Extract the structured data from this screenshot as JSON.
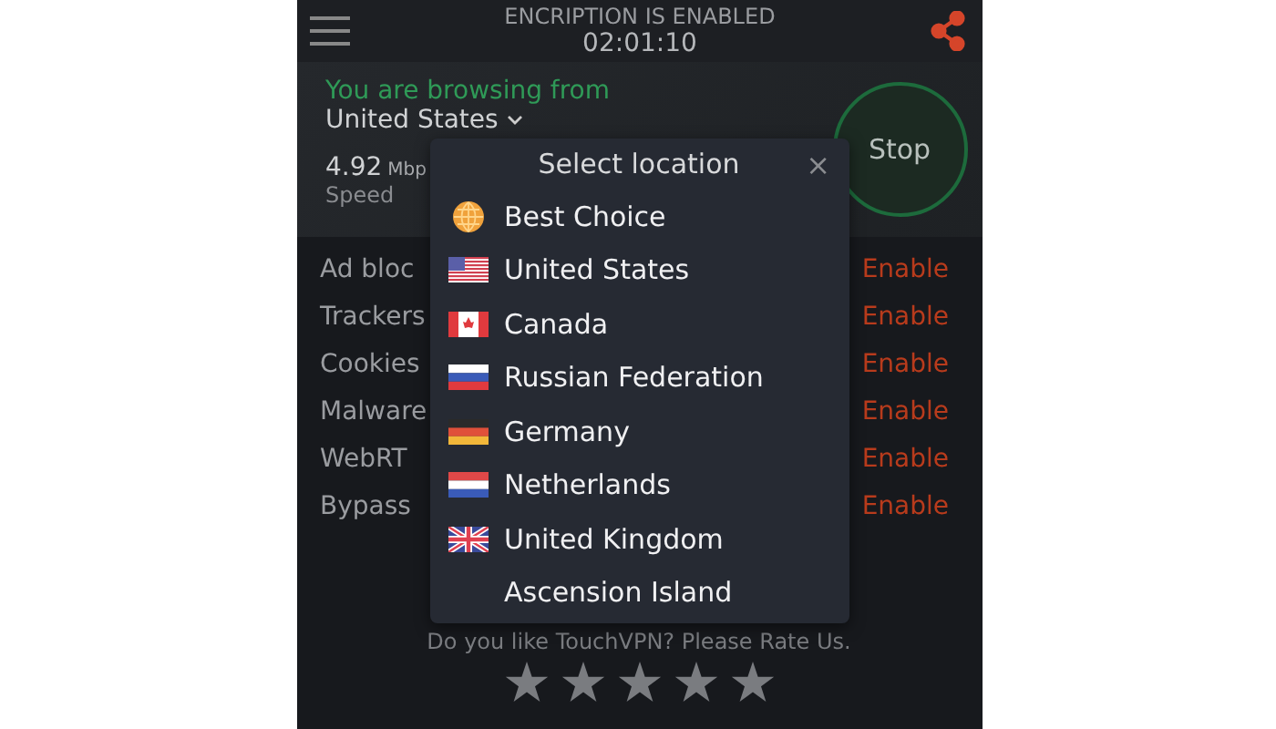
{
  "header": {
    "status": "ENCRIPTION IS ENABLED",
    "timer": "02:01:10"
  },
  "connection": {
    "prompt": "You are browsing from",
    "location": "United States",
    "speed_value": "4.92",
    "speed_unit": "Mbp",
    "speed_label": "Speed",
    "stop_button": "Stop"
  },
  "features": [
    {
      "label": "Ad bloc",
      "action": "Enable"
    },
    {
      "label": "Trackers",
      "action": "Enable"
    },
    {
      "label": "Cookies",
      "action": "Enable"
    },
    {
      "label": "Malware",
      "action": "Enable"
    },
    {
      "label": "WebRT",
      "action": "Enable"
    },
    {
      "label": "Bypass",
      "action": "Enable"
    }
  ],
  "rating": {
    "prompt": "Do you like TouchVPN? Please Rate Us."
  },
  "location_dialog": {
    "title": "Select location",
    "close": "×",
    "locations": [
      {
        "name": "Best Choice",
        "kind": "globe"
      },
      {
        "name": "United States",
        "kind": "us"
      },
      {
        "name": "Canada",
        "kind": "ca"
      },
      {
        "name": "Russian Federation",
        "kind": "ru"
      },
      {
        "name": "Germany",
        "kind": "de"
      },
      {
        "name": "Netherlands",
        "kind": "nl"
      },
      {
        "name": "United Kingdom",
        "kind": "gb"
      },
      {
        "name": "Ascension Island",
        "kind": "none"
      }
    ]
  }
}
